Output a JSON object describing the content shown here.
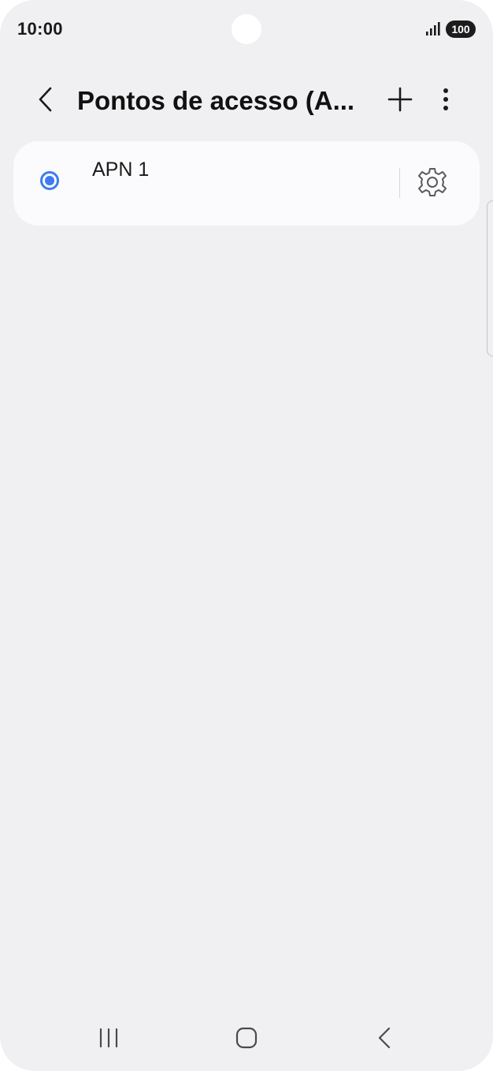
{
  "status_bar": {
    "time": "10:00",
    "signal_icon": "signal-bars-icon",
    "battery_level": "100"
  },
  "app_bar": {
    "title": "Pontos de acesso (A...",
    "back_icon": "chevron-left-icon",
    "add_icon": "plus-icon",
    "more_icon": "more-vertical-icon"
  },
  "apn_list": [
    {
      "name": "APN 1",
      "selected": true,
      "settings_icon": "gear-icon"
    }
  ],
  "nav_bar": {
    "recents_icon": "recents-icon",
    "home_icon": "home-icon",
    "back_icon": "back-chevron-icon"
  },
  "colors": {
    "accent": "#3e7bf0",
    "background": "#f0f0f3",
    "card": "#fbfbfd"
  }
}
